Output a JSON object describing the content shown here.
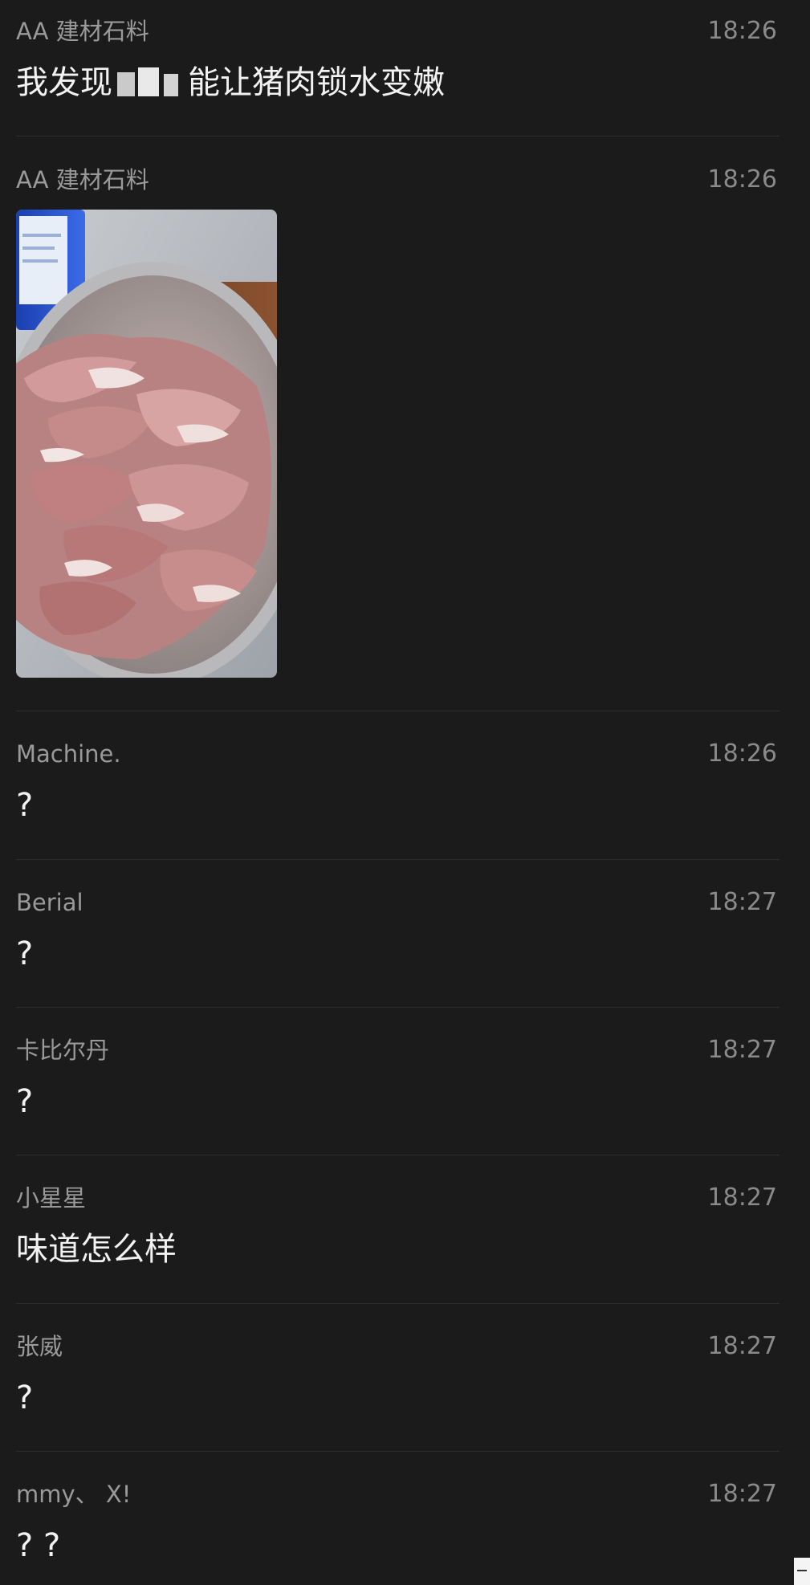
{
  "messages": [
    {
      "sender": "AA 建材石料",
      "time": "18:26",
      "text_before": "我发现",
      "text_after": "能让猪肉锁水变嫩"
    },
    {
      "sender": "AA 建材石料",
      "time": "18:26",
      "image": "pork-in-bowl-photo"
    },
    {
      "sender": "Machine.",
      "time": "18:26",
      "text": "?"
    },
    {
      "sender": "Berial",
      "time": "18:27",
      "text": "?"
    },
    {
      "sender": "卡比尔丹",
      "time": "18:27",
      "text": "?"
    },
    {
      "sender": "小星星",
      "time": "18:27",
      "text": "味道怎么样"
    },
    {
      "sender": "张威",
      "time": "18:27",
      "text": "?"
    },
    {
      "sender": "mmy、 X!",
      "time": "18:27",
      "text": "? ?"
    }
  ],
  "colors": {
    "background": "#1b1b1b",
    "sender": "#9a9a9a",
    "time": "#8a8a8a",
    "message": "#f2f2f2",
    "divider": "#2e2e2e"
  }
}
